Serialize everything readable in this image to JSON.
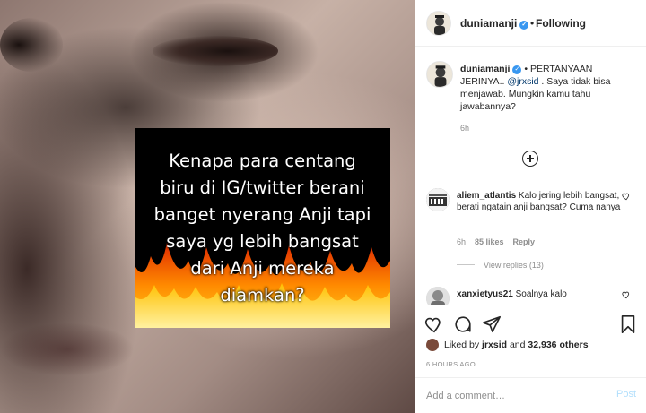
{
  "post_image": {
    "quote_lines": [
      "Kenapa para centang",
      "biru di IG/twitter berani",
      "banget nyerang Anji tapi",
      "saya yg lebih bangsat",
      "dari Anji mereka",
      "diamkan?"
    ]
  },
  "header": {
    "username": "duniamanji",
    "separator": "•",
    "follow_label": "Following"
  },
  "caption": {
    "username": "duniamanji",
    "text_prefix": " • PERTANYAAN JERINYA.. ",
    "mention": "@jrxsid",
    "text_suffix": " . Saya tidak bisa menjawab. Mungkin kamu tahu jawabannya?",
    "time": "6h"
  },
  "comments": [
    {
      "username": "aliem_atlantis",
      "text": " Kalo jering lebih bangsat, berati ngatain anji bangsat? Cuma nanya",
      "time": "6h",
      "likes": "85 likes",
      "reply_label": "Reply",
      "view_replies": "View replies (13)"
    },
    {
      "username": "xanxietyus21",
      "text": " Soalnya kalo"
    }
  ],
  "likes": {
    "prefix": "Liked by ",
    "user": "jrxsid",
    "middle": " and ",
    "count": "32,936 others"
  },
  "post_time": "6 HOURS AGO",
  "add_comment": {
    "placeholder": "Add a comment…",
    "post_label": "Post"
  },
  "colors": {
    "verified": "#3897f0",
    "mention": "#00376b",
    "post_disabled": "#b2dffc",
    "muted": "#8e8e8e"
  },
  "icons": {
    "like": "heart-icon",
    "comment": "comment-icon",
    "share": "paper-plane-icon",
    "save": "bookmark-icon",
    "more": "plus-circle-icon"
  }
}
